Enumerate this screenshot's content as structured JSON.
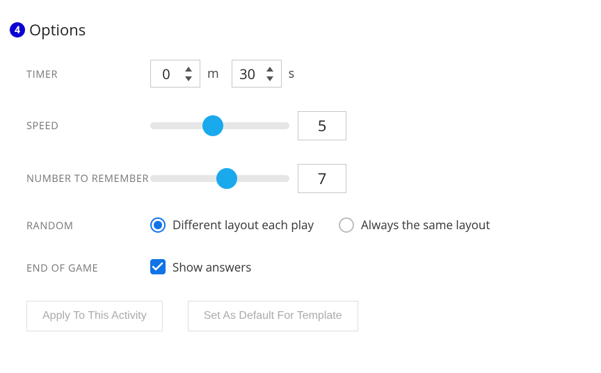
{
  "step_number": "4",
  "title": "Options",
  "timer": {
    "label": "TIMER",
    "minutes": "0",
    "minutes_unit": "m",
    "seconds": "30",
    "seconds_unit": "s"
  },
  "speed": {
    "label": "SPEED",
    "value": "5",
    "percent": 45
  },
  "number_to_remember": {
    "label": "NUMBER TO REMEMBER",
    "value": "7",
    "percent": 55
  },
  "random": {
    "label": "RANDOM",
    "option_a": "Different layout each play",
    "option_b": "Always the same layout",
    "selected": "a"
  },
  "end_of_game": {
    "label": "END OF GAME",
    "show_answers_label": "Show answers",
    "show_answers_checked": true
  },
  "buttons": {
    "apply": "Apply To This Activity",
    "set_default": "Set As Default For Template"
  }
}
